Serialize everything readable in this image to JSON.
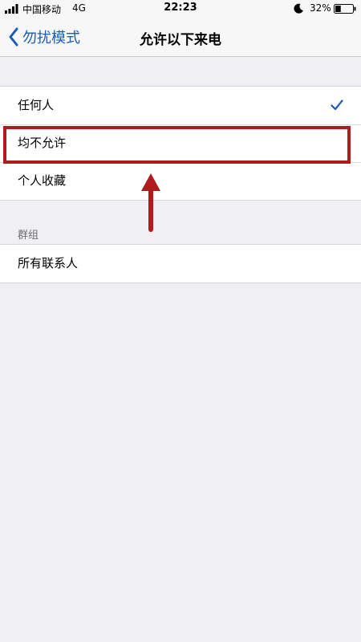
{
  "status_bar": {
    "carrier": "中国移动",
    "network": "4G",
    "time": "22:23",
    "battery_percent": "32%",
    "battery_level": 0.32,
    "icons": [
      "signal-icon",
      "moon-icon",
      "battery-icon"
    ]
  },
  "nav": {
    "back_label": "勿扰模式",
    "title": "允许以下来电"
  },
  "options": [
    {
      "label": "任何人",
      "checked": true
    },
    {
      "label": "均不允许",
      "checked": false
    },
    {
      "label": "个人收藏",
      "checked": false
    }
  ],
  "groups_section": {
    "header": "群组",
    "items": [
      {
        "label": "所有联系人"
      }
    ]
  },
  "colors": {
    "accent": "#1a5cb8",
    "annotation": "#b01c1c",
    "background": "#efeff4"
  }
}
